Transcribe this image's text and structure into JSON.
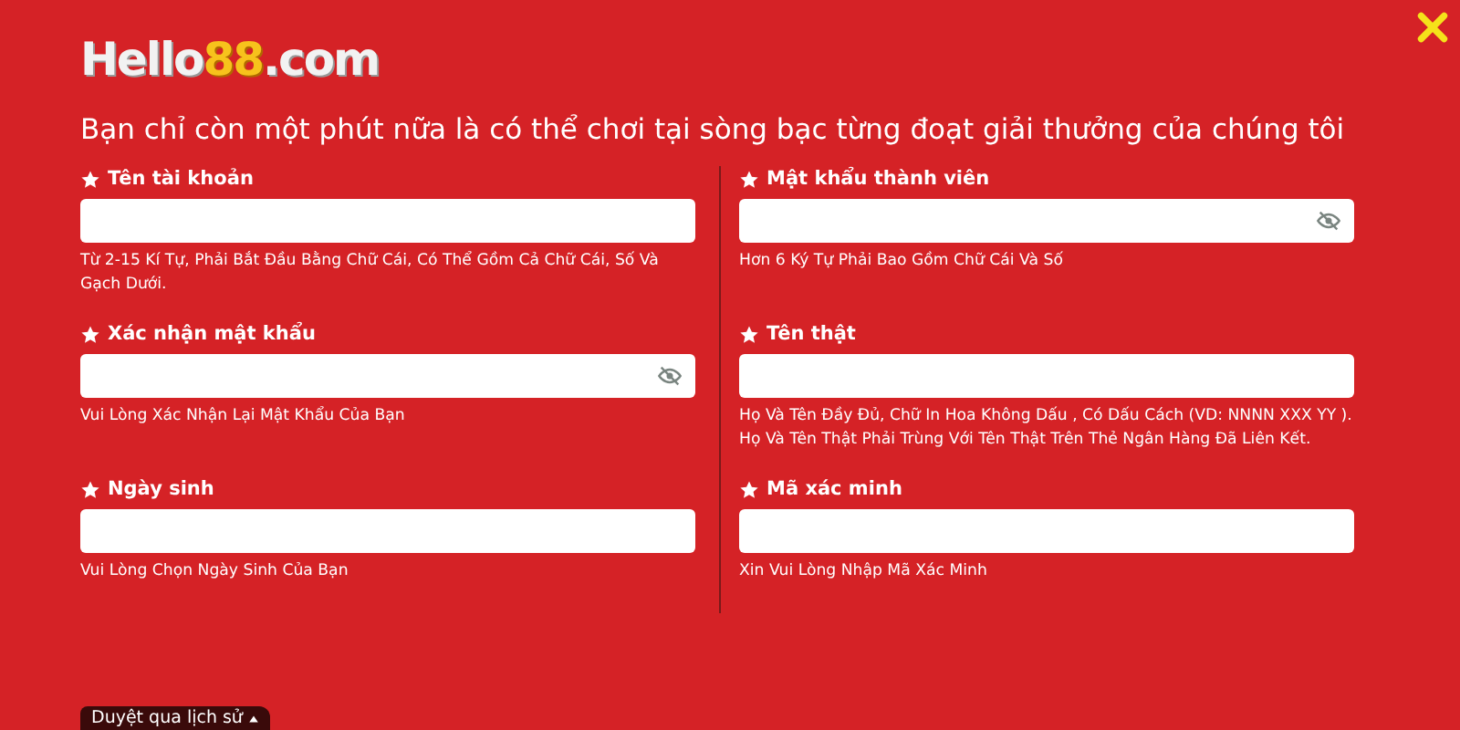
{
  "logo": {
    "name": "Hello",
    "number": "88",
    "domain": ".com"
  },
  "title": "Bạn chỉ còn một phút nữa là có thể chơi tại sòng bạc từng đoạt giải thưởng của chúng tôi",
  "fields": [
    {
      "label": "Tên tài khoản",
      "kind": "text",
      "hint": "Từ 2-15 Kí Tự, Phải Bắt Đầu Bằng Chữ Cái, Có Thể Gồm Cả Chữ Cái, Số Và Gạch Dưới."
    },
    {
      "label": "Mật khẩu thành viên",
      "kind": "password",
      "hint": "Hơn 6 Ký Tự Phải Bao Gồm Chữ Cái Và Số"
    },
    {
      "label": "Xác nhận mật khẩu",
      "kind": "password",
      "hint": "Vui Lòng Xác Nhận Lại Mật Khẩu Của Bạn"
    },
    {
      "label": "Tên thật",
      "kind": "text",
      "hint": "Họ Và Tên Đầy Đủ, Chữ In Hoa Không Dấu , Có Dấu Cách (VD: NNNN XXX YY ). Họ Và Tên Thật Phải Trùng Với Tên Thật Trên Thẻ Ngân Hàng Đã Liên Kết."
    },
    {
      "label": "Ngày sinh",
      "kind": "text",
      "hint": "Vui Lòng Chọn Ngày Sinh Của Bạn"
    },
    {
      "label": "Mã xác minh",
      "kind": "text",
      "hint": "Xin Vui Lòng Nhập Mã Xác Minh"
    }
  ],
  "history_tab": {
    "label": "Duyệt qua lịch sử"
  }
}
